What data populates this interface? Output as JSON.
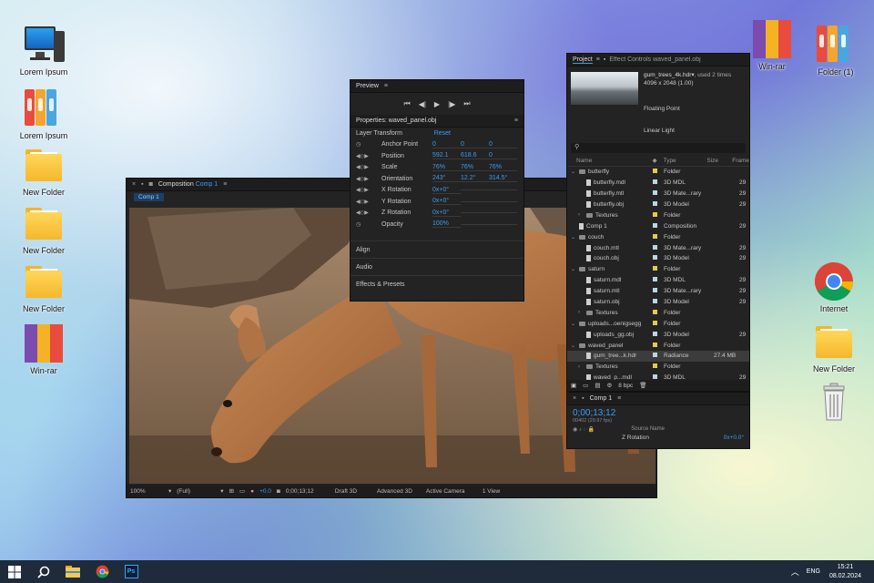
{
  "desktop": {
    "left_icons": [
      {
        "label": "Lorem Ipsum",
        "icon": "computer-icon"
      },
      {
        "label": "Lorem Ipsum",
        "icon": "binders-icon"
      },
      {
        "label": "New Folder",
        "icon": "folder-icon"
      },
      {
        "label": "New Folder",
        "icon": "folder-icon"
      },
      {
        "label": "New Folder",
        "icon": "folder-icon"
      },
      {
        "label": "Win-rar",
        "icon": "winrar-icon"
      }
    ],
    "right_icons": [
      {
        "label": "Win-rar",
        "icon": "winrar-icon"
      },
      {
        "label": "Folder (1)",
        "icon": "binders-icon"
      },
      {
        "label": "Internet",
        "icon": "chrome-icon"
      },
      {
        "label": "New Folder",
        "icon": "folder-icon"
      },
      {
        "label": "",
        "icon": "recycle-bin-icon"
      }
    ]
  },
  "composition": {
    "tab_prefix": "Composition",
    "tab_name": "Comp 1",
    "sub_tab": "Comp 1",
    "footer": {
      "zoom": "100%",
      "resolution": "(Full)",
      "exposure": "+0.0",
      "timecode": "0;00;13;12",
      "draft": "Draft 3D",
      "renderer": "Advanced 3D",
      "camera": "Active Camera",
      "view": "1 View"
    }
  },
  "preview": {
    "title": "Preview",
    "properties_title": "Properties: waved_panel.obj",
    "layer_transform": "Layer Transform",
    "reset": "Reset",
    "props": [
      {
        "name": "Anchor Point",
        "v1": "0",
        "v2": "0",
        "v3": "0"
      },
      {
        "name": "Position",
        "v1": "592.1",
        "v2": "618.6",
        "v3": "0"
      },
      {
        "name": "Scale",
        "v1": "76%",
        "v2": "76%",
        "v3": "76%"
      },
      {
        "name": "Orientation",
        "v1": "243°",
        "v2": "12.2°",
        "v3": "314.5°"
      },
      {
        "name": "X Rotation",
        "v1": "0x+0°",
        "v2": "",
        "v3": ""
      },
      {
        "name": "Y Rotation",
        "v1": "0x+0°",
        "v2": "",
        "v3": ""
      },
      {
        "name": "Z Rotation",
        "v1": "0x+0°",
        "v2": "",
        "v3": ""
      },
      {
        "name": "Opacity",
        "v1": "100%",
        "v2": "",
        "v3": ""
      }
    ],
    "sections": [
      "Align",
      "Audio",
      "Effects & Presets"
    ]
  },
  "project": {
    "tab": "Project",
    "tab2": "Effect Controls waved_panel.obj",
    "file_name": "gum_trees_4k.hdr",
    "file_used": ", used 2 times",
    "file_dims": "4096 x 2048 (1.00)",
    "file_depth": "Floating Point",
    "file_light": "Linear Light",
    "columns": {
      "name": "Name",
      "type": "Type",
      "size": "Size",
      "frame": "Frame"
    },
    "rows": [
      {
        "name": "butterfly",
        "type": "Folder",
        "size": "",
        "frame": "",
        "kind": "folder",
        "indent": 0,
        "color": "#e7c84a"
      },
      {
        "name": "butterfly.mdl",
        "type": "3D MDL",
        "size": "",
        "frame": "29",
        "kind": "file",
        "indent": 1,
        "color": "#b7d7e2"
      },
      {
        "name": "butterfly.mtl",
        "type": "3D Mate...rary",
        "size": "",
        "frame": "29",
        "kind": "file",
        "indent": 1,
        "color": "#b7d7e2"
      },
      {
        "name": "butterfly.obj",
        "type": "3D Model",
        "size": "",
        "frame": "29",
        "kind": "file",
        "indent": 1,
        "color": "#b7d7e2"
      },
      {
        "name": "Textures",
        "type": "Folder",
        "size": "",
        "frame": "",
        "kind": "folder",
        "indent": 1,
        "color": "#e7c84a"
      },
      {
        "name": "Comp 1",
        "type": "Composition",
        "size": "",
        "frame": "29",
        "kind": "comp",
        "indent": 0,
        "color": "#b7d7e2"
      },
      {
        "name": "couch",
        "type": "Folder",
        "size": "",
        "frame": "",
        "kind": "folder",
        "indent": 0,
        "color": "#e7c84a"
      },
      {
        "name": "couch.mtl",
        "type": "3D Mate...rary",
        "size": "",
        "frame": "29",
        "kind": "file",
        "indent": 1,
        "color": "#b7d7e2"
      },
      {
        "name": "couch.obj",
        "type": "3D Model",
        "size": "",
        "frame": "29",
        "kind": "file",
        "indent": 1,
        "color": "#b7d7e2"
      },
      {
        "name": "saturn",
        "type": "Folder",
        "size": "",
        "frame": "",
        "kind": "folder",
        "indent": 0,
        "color": "#e7c84a"
      },
      {
        "name": "saturn.mdl",
        "type": "3D MDL",
        "size": "",
        "frame": "29",
        "kind": "file",
        "indent": 1,
        "color": "#b7d7e2"
      },
      {
        "name": "saturn.mtl",
        "type": "3D Mate...rary",
        "size": "",
        "frame": "29",
        "kind": "file",
        "indent": 1,
        "color": "#b7d7e2"
      },
      {
        "name": "saturn.obj",
        "type": "3D Model",
        "size": "",
        "frame": "29",
        "kind": "file",
        "indent": 1,
        "color": "#b7d7e2"
      },
      {
        "name": "Textures",
        "type": "Folder",
        "size": "",
        "frame": "",
        "kind": "folder",
        "indent": 1,
        "color": "#e7c84a"
      },
      {
        "name": "uploads...oenigsegg",
        "type": "Folder",
        "size": "",
        "frame": "",
        "kind": "folder",
        "indent": 0,
        "color": "#e7c84a"
      },
      {
        "name": "uploads_gg.obj",
        "type": "3D Model",
        "size": "",
        "frame": "29",
        "kind": "file",
        "indent": 1,
        "color": "#b7d7e2"
      },
      {
        "name": "waved_panel",
        "type": "Folder",
        "size": "",
        "frame": "",
        "kind": "folder",
        "indent": 0,
        "color": "#e7c84a"
      },
      {
        "name": "gum_tree...k.hdr",
        "type": "Radiance",
        "size": "27.4 MB",
        "frame": "",
        "kind": "file",
        "indent": 1,
        "color": "#b7d7e2",
        "selected": true
      },
      {
        "name": "Textures",
        "type": "Folder",
        "size": "",
        "frame": "",
        "kind": "folder",
        "indent": 1,
        "color": "#e7c84a"
      },
      {
        "name": "waved_p...mdl",
        "type": "3D MDL",
        "size": "",
        "frame": "29",
        "kind": "file",
        "indent": 1,
        "color": "#b7d7e2"
      },
      {
        "name": "waved_p...mtl",
        "type": "3D Mate...rary",
        "size": "",
        "frame": "29",
        "kind": "file",
        "indent": 1,
        "color": "#b7d7e2"
      }
    ],
    "bpc": "8 bpc"
  },
  "timeline": {
    "tab": "Comp 1",
    "timecode": "0;00;13;12",
    "fps": "00402 (29.97 fps)",
    "source_name": "Source Name",
    "layer_prop": "Z Rotation",
    "layer_value": "0x+0.0°"
  },
  "taskbar": {
    "lang": "ENG",
    "time": "15:21",
    "date": "08.02.2024"
  },
  "colors": {
    "accent": "#3e9bf0",
    "panel_bg": "#232323",
    "taskbar_bg": "#1f2b3a"
  }
}
